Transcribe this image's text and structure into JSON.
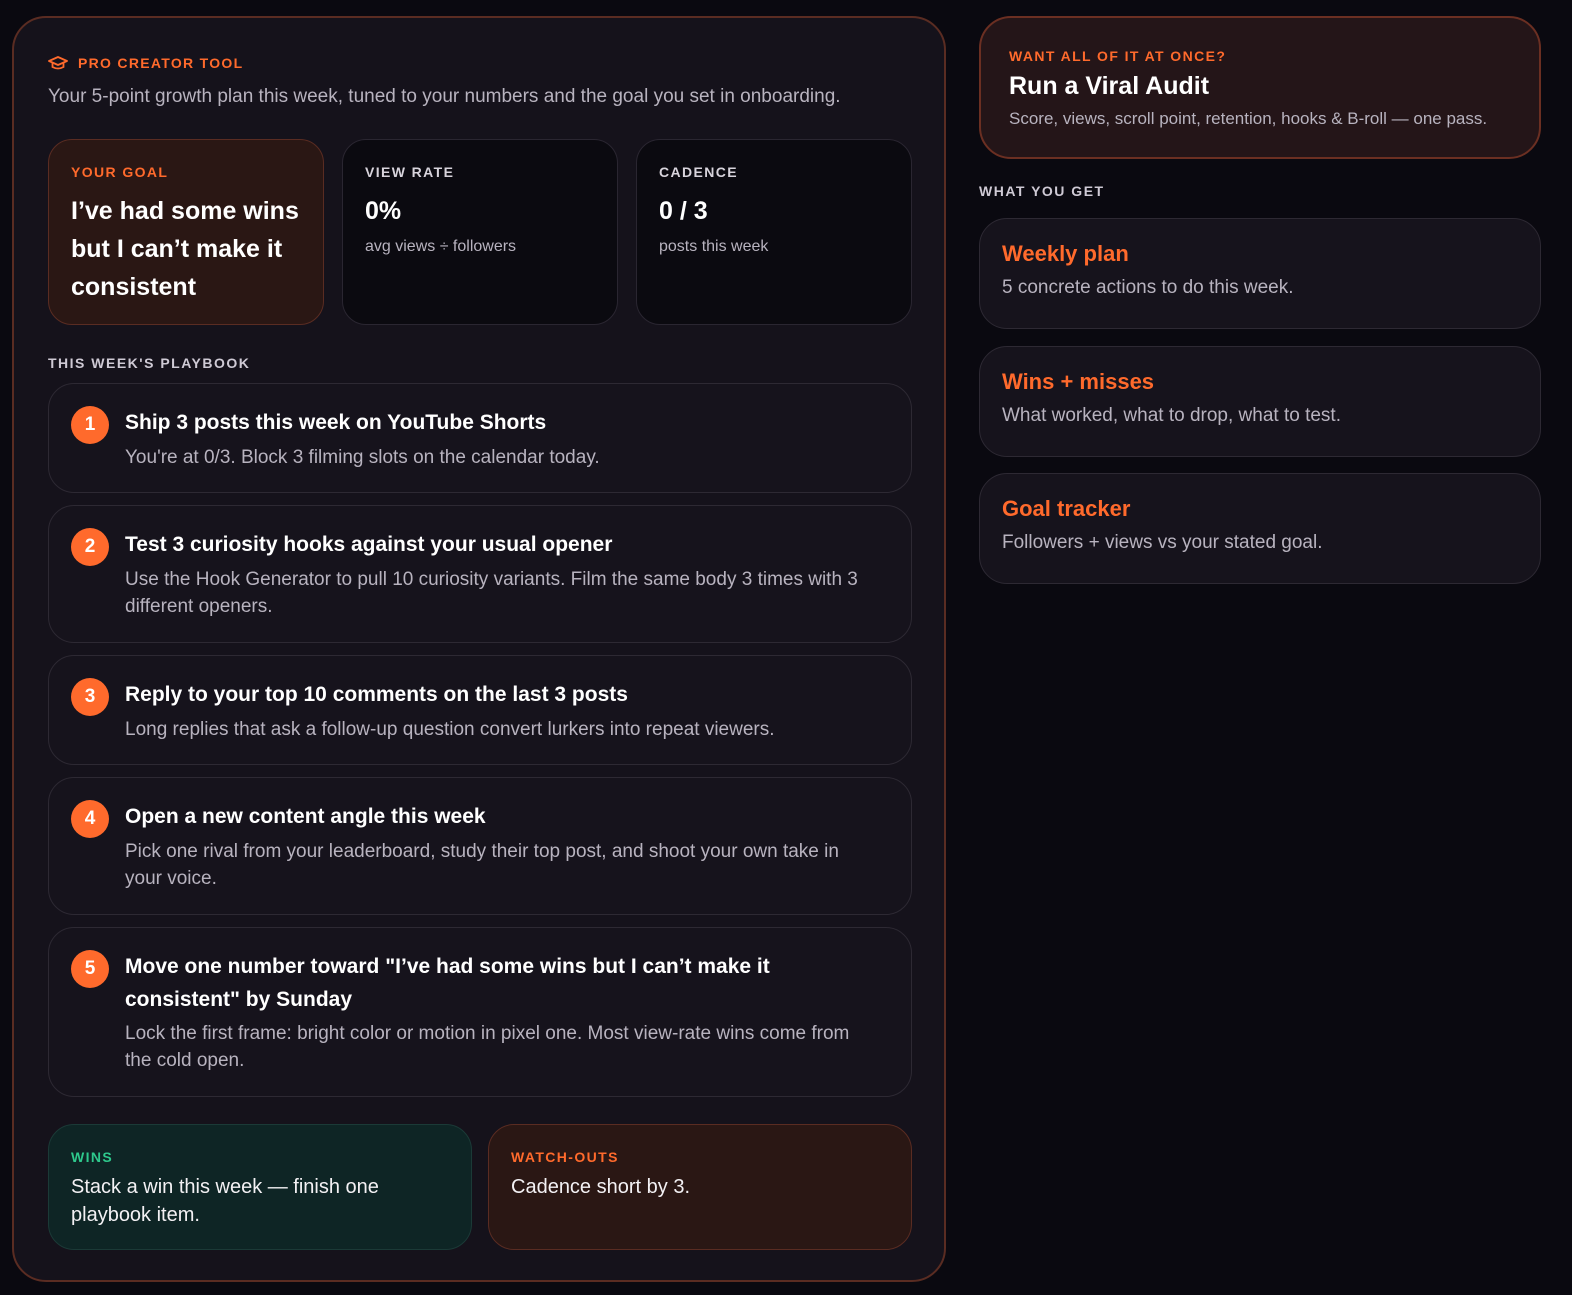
{
  "header": {
    "eyebrow": "PRO CREATOR TOOL",
    "subtitle": "Your 5-point growth plan this week, tuned to your numbers and the goal you set in onboarding."
  },
  "stats": {
    "goal": {
      "label": "YOUR GOAL",
      "value": "I’ve had some wins but I can’t make it consistent"
    },
    "view_rate": {
      "label": "VIEW RATE",
      "value": "0%",
      "sub": "avg views ÷ followers"
    },
    "cadence": {
      "label": "CADENCE",
      "value": "0 / 3",
      "sub": "posts this week"
    }
  },
  "playbook": {
    "heading": "THIS WEEK'S PLAYBOOK",
    "items": [
      {
        "num": "1",
        "title": "Ship 3 posts this week on YouTube Shorts",
        "body": "You're at 0/3. Block 3 filming slots on the calendar today."
      },
      {
        "num": "2",
        "title": "Test 3 curiosity hooks against your usual opener",
        "body": "Use the Hook Generator to pull 10 curiosity variants. Film the same body 3 times with 3 different openers."
      },
      {
        "num": "3",
        "title": "Reply to your top 10 comments on the last 3 posts",
        "body": "Long replies that ask a follow-up question convert lurkers into repeat viewers."
      },
      {
        "num": "4",
        "title": "Open a new content angle this week",
        "body": "Pick one rival from your leaderboard, study their top post, and shoot your own take in your voice."
      },
      {
        "num": "5",
        "title": "Move one number toward \"I’ve had some wins but I can’t make it consistent\" by Sunday",
        "body": "Lock the first frame: bright color or motion in pixel one. Most view-rate wins come from the cold open."
      }
    ]
  },
  "wins": {
    "label": "WINS",
    "text": "Stack a win this week — finish one playbook item."
  },
  "watchouts": {
    "label": "WATCH-OUTS",
    "text": "Cadence short by 3."
  },
  "audit": {
    "eyebrow": "WANT ALL OF IT AT ONCE?",
    "title": "Run a Viral Audit",
    "desc": "Score, views, scroll point, retention, hooks & B-roll — one pass."
  },
  "what_you_get": {
    "heading": "WHAT YOU GET",
    "items": [
      {
        "title": "Weekly plan",
        "desc": "5 concrete actions to do this week."
      },
      {
        "title": "Wins + misses",
        "desc": "What worked, what to drop, what to test."
      },
      {
        "title": "Goal tracker",
        "desc": "Followers + views vs your stated goal."
      }
    ]
  },
  "colors": {
    "accent": "#ff6a2c",
    "success": "#2ec88c",
    "background": "#0a0910",
    "panel": "#15121b"
  },
  "icons": {
    "eyebrow_icon": "graduation-cap-icon"
  }
}
